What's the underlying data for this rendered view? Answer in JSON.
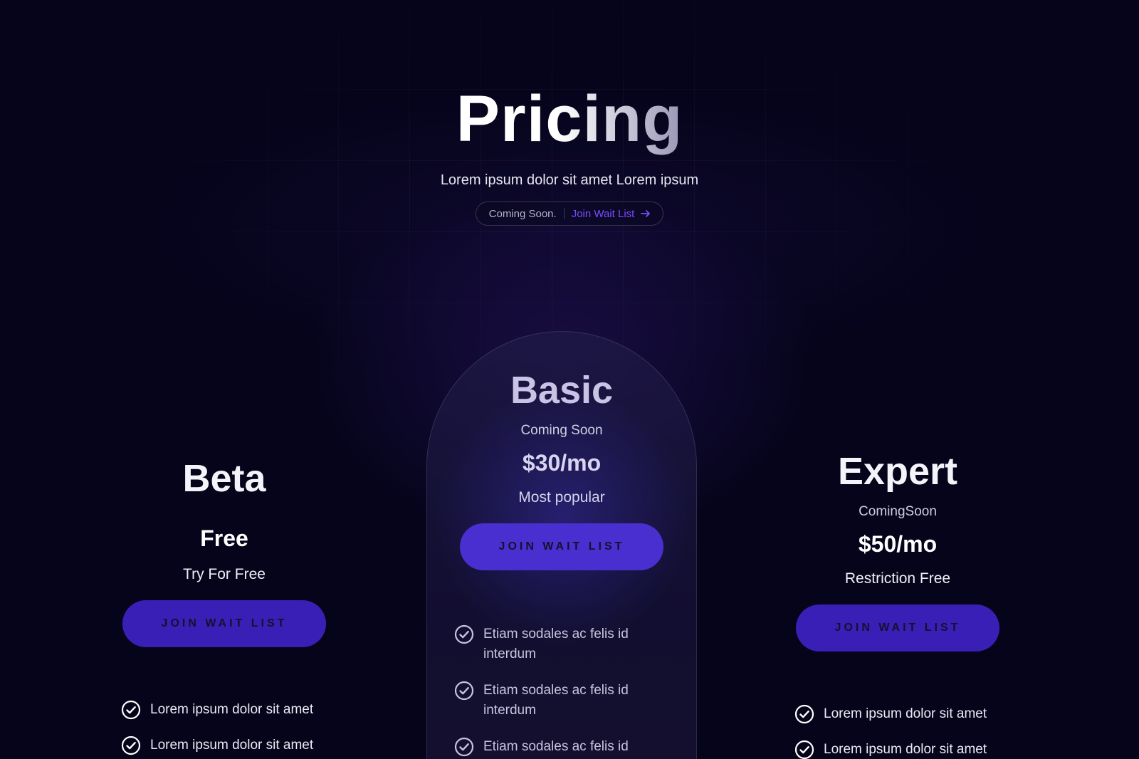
{
  "header": {
    "title": "Pricing",
    "subtitle": "Lorem ipsum dolor sit amet Lorem ipsum",
    "pill_text": "Coming Soon.",
    "pill_link": "Join Wait List"
  },
  "plans": {
    "beta": {
      "name": "Beta",
      "price": "Free",
      "tag": "Try For Free",
      "cta": "JOIN WAIT LIST",
      "features": [
        "Lorem ipsum dolor sit amet",
        "Lorem ipsum dolor sit amet"
      ]
    },
    "basic": {
      "name": "Basic",
      "note": "Coming Soon",
      "price": "$30/mo",
      "tag": "Most popular",
      "cta": "JOIN WAIT LIST",
      "features": [
        "Etiam sodales ac felis id interdum",
        "Etiam sodales ac felis id interdum",
        "Etiam sodales ac felis id interdum"
      ]
    },
    "expert": {
      "name": "Expert",
      "note": "ComingSoon",
      "price": "$50/mo",
      "tag": "Restriction Free",
      "cta": "JOIN WAIT LIST",
      "features": [
        "Lorem ipsum dolor sit amet",
        "Lorem ipsum dolor sit amet"
      ]
    }
  },
  "icons": {
    "check": "check-circle-icon",
    "arrow": "arrow-right-icon"
  },
  "colors": {
    "background": "#05041a",
    "accent": "#7a4dff",
    "button": "#3a1fb6",
    "button_featured": "#4a2fd0"
  }
}
